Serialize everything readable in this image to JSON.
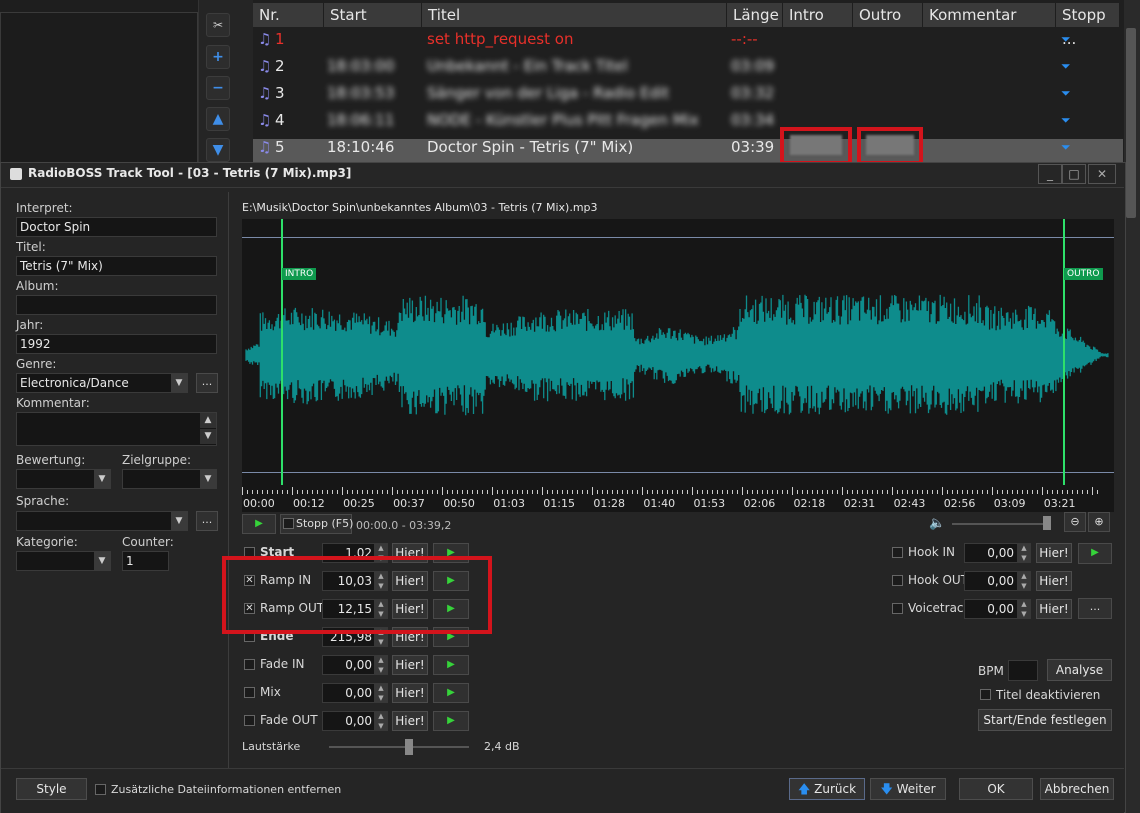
{
  "playlist": {
    "columns": [
      "Nr.",
      "Start",
      "Titel",
      "Länge",
      "Intro",
      "Outro",
      "Kommentar",
      "Stopp ..."
    ],
    "rows": [
      {
        "nr": "1",
        "start": "",
        "title": "set http_request on",
        "length": "--:--",
        "highlight": "red"
      },
      {
        "nr": "2",
        "start": "18:03:00",
        "title": "Unbekannt - Ein Track Titel",
        "length": "03:09",
        "blurred": true
      },
      {
        "nr": "3",
        "start": "18:03:53",
        "title": "Sänger von der Liga - Radio Edit",
        "length": "03:32",
        "blurred": true
      },
      {
        "nr": "4",
        "start": "18:06:11",
        "title": "NODE - Künstler Plus Pitt Fragen Mix",
        "length": "03:34",
        "blurred": true
      },
      {
        "nr": "5",
        "start": "18:10:46",
        "title": "Doctor Spin - Tetris (7\" Mix)",
        "length": "03:39",
        "selected": true
      }
    ]
  },
  "dialog": {
    "title": "RadioBOSS Track Tool - [03 - Tetris (7  Mix).mp3]",
    "filepath": "E:\\Musik\\Doctor Spin\\unbekanntes Album\\03 - Tetris (7  Mix).mp3",
    "meta": {
      "interpret_label": "Interpret:",
      "interpret": "Doctor Spin",
      "titel_label": "Titel:",
      "titel": "Tetris (7\" Mix)",
      "album_label": "Album:",
      "album": "",
      "jahr_label": "Jahr:",
      "jahr": "1992",
      "genre_label": "Genre:",
      "genre": "Electronica/Dance",
      "kommentar_label": "Kommentar:",
      "bewertung_label": "Bewertung:",
      "zielgruppe_label": "Zielgruppe:",
      "sprache_label": "Sprache:",
      "kategorie_label": "Kategorie:",
      "counter_label": "Counter:",
      "counter": "1",
      "more": "..."
    },
    "wave": {
      "intro_label": "INTRO",
      "outro_label": "OUTRO",
      "ticks": [
        "00:00",
        "00:12",
        "00:25",
        "00:37",
        "00:50",
        "01:03",
        "01:15",
        "01:28",
        "01:40",
        "01:53",
        "02:06",
        "02:18",
        "02:31",
        "02:43",
        "02:56",
        "03:09",
        "03:21"
      ],
      "wave_color": "#0e8c8c",
      "marker_color": "#2ee06a"
    },
    "transport": {
      "stop_label": "Stopp (F5)",
      "time_range": "00:00.0 - 03:39,2"
    },
    "cues": [
      {
        "label": "Start",
        "value": "1,02",
        "checked": false,
        "bold": true
      },
      {
        "label": "Ramp IN",
        "value": "10,03",
        "checked": true
      },
      {
        "label": "Ramp OUT",
        "value": "12,15",
        "checked": true
      },
      {
        "label": "Ende",
        "value": "215,98",
        "checked": false,
        "bold": true
      },
      {
        "label": "Fade IN",
        "value": "0,00",
        "checked": false
      },
      {
        "label": "Mix",
        "value": "0,00",
        "checked": false
      },
      {
        "label": "Fade OUT",
        "value": "0,00",
        "checked": false
      }
    ],
    "hier_label": "Hier!",
    "right_cues": [
      {
        "label": "Hook IN",
        "value": "0,00"
      },
      {
        "label": "Hook OUT",
        "value": "0,00"
      },
      {
        "label": "Voicetrack",
        "value": "0,00"
      }
    ],
    "volume_label": "Lautstärke",
    "volume_value": "2,4 dB",
    "volume_level": 0.57,
    "bpm_label": "BPM",
    "analyse_label": "Analyse",
    "deactivate_label": "Titel deaktivieren",
    "startende_label": "Start/Ende festlegen",
    "bottom": {
      "style_label": "Style",
      "remove_info_label": "Zusätzliche Dateiinformationen entfernen",
      "back_label": "Zurück",
      "next_label": "Weiter",
      "ok_label": "OK",
      "cancel_label": "Abbrechen"
    }
  },
  "colors": {
    "highlight_red": "#d3141c",
    "accent_blue": "#2a8ef0",
    "play_green": "#36d33a"
  }
}
